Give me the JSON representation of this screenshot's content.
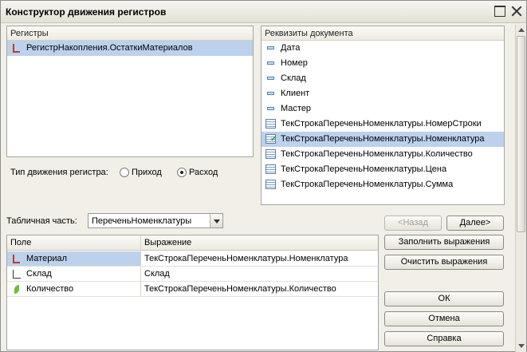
{
  "window": {
    "title": "Конструктор движения регистров"
  },
  "registers": {
    "header": "Регистры",
    "items": [
      {
        "label": "РегистрНакопления.ОстаткиМатериалов",
        "icon": "register-icon",
        "selected": true
      }
    ]
  },
  "movement_type": {
    "label": "Тип движения регистра:",
    "options": [
      "Приход",
      "Расход"
    ],
    "selected": "Расход"
  },
  "doc_attributes": {
    "header": "Реквизиты документа",
    "items": [
      {
        "label": "Дата",
        "icon": "field-icon"
      },
      {
        "label": "Номер",
        "icon": "field-icon"
      },
      {
        "label": "Склад",
        "icon": "field-icon"
      },
      {
        "label": "Клиент",
        "icon": "field-icon"
      },
      {
        "label": "Мастер",
        "icon": "field-icon"
      },
      {
        "label": "ТекСтрокаПереченьНоменклатуры.НомерСтроки",
        "icon": "table-field-icon"
      },
      {
        "label": "ТекСтрокаПереченьНоменклатуры.Номенклатура",
        "icon": "table-field-check-icon",
        "selected": true
      },
      {
        "label": "ТекСтрокаПереченьНоменклатуры.Количество",
        "icon": "table-field-icon"
      },
      {
        "label": "ТекСтрокаПереченьНоменклатуры.Цена",
        "icon": "table-field-icon"
      },
      {
        "label": "ТекСтрокаПереченьНоменклатуры.Сумма",
        "icon": "table-field-icon"
      }
    ]
  },
  "tabular": {
    "label": "Табличная часть:",
    "value": "ПереченьНоменклатуры"
  },
  "nav": {
    "back": "<Назад",
    "next": "Далее>"
  },
  "grid": {
    "columns": [
      "Поле",
      "Выражение"
    ],
    "rows": [
      {
        "field": "Материал",
        "expression": "ТекСтрокаПереченьНоменклатуры.Номенклатура",
        "icon": "dimension-icon",
        "selected": true
      },
      {
        "field": "Склад",
        "expression": "Склад",
        "icon": "dimension-icon"
      },
      {
        "field": "Количество",
        "expression": "ТекСтрокаПереченьНоменклатуры.Количество",
        "icon": "resource-icon"
      }
    ]
  },
  "buttons": {
    "fill": "Заполнить выражения",
    "clear": "Очистить выражения",
    "ok": "ОК",
    "cancel": "Отмена",
    "help": "Справка"
  },
  "colors": {
    "selection": "#bcd1ec",
    "window_bg": "#f1efe7"
  }
}
